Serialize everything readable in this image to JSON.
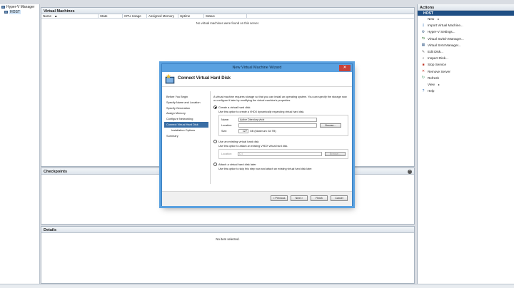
{
  "tree": {
    "root": "Hyper-V Manager",
    "host": "HOST"
  },
  "vm_pane": {
    "title": "Virtual Machines",
    "columns": [
      "Name",
      "State",
      "CPU Usage",
      "Assigned Memory",
      "Uptime",
      "Status"
    ],
    "empty": "No virtual machines were found on this server."
  },
  "checkpoints": {
    "title": "Checkpoints"
  },
  "details": {
    "title": "Details",
    "empty": "No item selected."
  },
  "actions": {
    "title": "Actions",
    "group": "HOST",
    "items": [
      {
        "label": "New",
        "icon": "none",
        "arrow": true
      },
      {
        "label": "Import Virtual Machine...",
        "icon": "import-icon"
      },
      {
        "label": "Hyper-V Settings...",
        "icon": "settings-icon"
      },
      {
        "label": "Virtual Switch Manager...",
        "icon": "switch-icon"
      },
      {
        "label": "Virtual SAN Manager...",
        "icon": "san-icon"
      },
      {
        "label": "Edit Disk...",
        "icon": "edit-disk-icon"
      },
      {
        "label": "Inspect Disk...",
        "icon": "inspect-disk-icon"
      },
      {
        "label": "Stop Service",
        "icon": "stop-icon"
      },
      {
        "label": "Remove Server",
        "icon": "remove-icon"
      },
      {
        "label": "Refresh",
        "icon": "refresh-icon"
      },
      {
        "label": "View",
        "icon": "none",
        "arrow": true
      },
      {
        "label": "Help",
        "icon": "help-icon"
      }
    ]
  },
  "wizard": {
    "title": "New Virtual Machine Wizard",
    "close": "✕",
    "banner": "Connect Virtual Hard Disk",
    "steps": [
      {
        "label": "Before You Begin"
      },
      {
        "label": "Specify Name and Location"
      },
      {
        "label": "Specify Generation"
      },
      {
        "label": "Assign Memory"
      },
      {
        "label": "Configure Networking"
      },
      {
        "label": "Connect Virtual Hard Disk",
        "active": true
      },
      {
        "label": "Installation Options",
        "sub": true
      },
      {
        "label": "Summary"
      }
    ],
    "intro": "A virtual machine requires storage so that you can install an operating system. You can specify the storage now or configure it later by modifying the virtual machine's properties.",
    "opt_create": "Create a virtual hard disk",
    "opt_create_desc": "Use this option to create a VHDX dynamically expanding virtual hard disk.",
    "name_label": "Name:",
    "name_value": "Active Directory.vhdx",
    "location_label": "Location:",
    "location_value": "",
    "browse1": "Browse...",
    "size_label": "Size:",
    "size_value": "127",
    "size_unit": "GB (Maximum: 64 TB)",
    "opt_existing": "Use an existing virtual hard disk",
    "opt_existing_desc": "Use this option to attach an existing VHDX virtual hard disk.",
    "location2_label": "Location:",
    "location2_value": "C:\\",
    "browse2": "Browse...",
    "opt_later": "Attach a virtual hard disk later",
    "opt_later_desc": "Use this option to skip this step now and attach an existing virtual hard disk later.",
    "buttons": {
      "previous": "< Previous",
      "next": "Next >",
      "finish": "Finish",
      "cancel": "Cancel"
    }
  }
}
